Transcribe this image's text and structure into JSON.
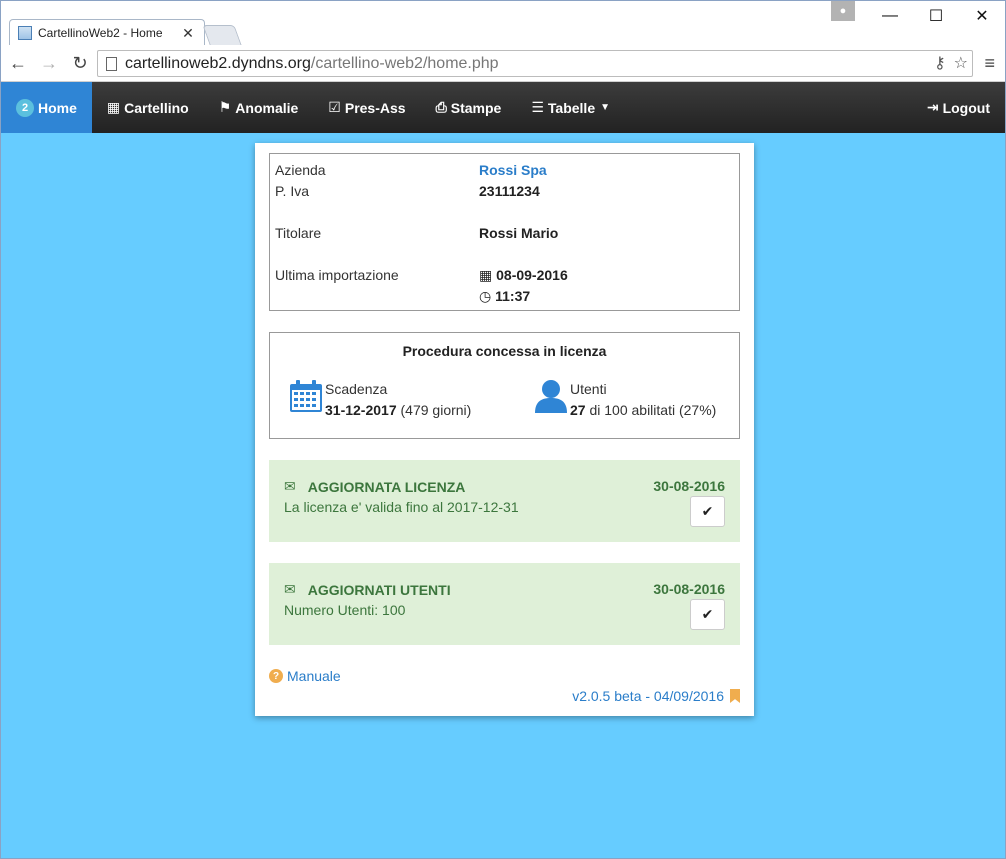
{
  "browser": {
    "tab_title": "CartellinoWeb2 - Home",
    "tab_close": "✕",
    "url_host": "cartellinoweb2.dyndns.org",
    "url_path": "/cartellino-web2/home.php",
    "controls": {
      "minimize": "—",
      "maximize": "☐",
      "close": "✕"
    }
  },
  "navbar": {
    "home_badge": "2",
    "home": "Home",
    "cartellino": "Cartellino",
    "anomalie": "Anomalie",
    "presass": "Pres-Ass",
    "stampe": "Stampe",
    "tabelle": "Tabelle",
    "logout": "Logout"
  },
  "company": {
    "azienda_label": "Azienda",
    "azienda_value": "Rossi Spa",
    "piva_label": "P. Iva",
    "piva_value": "23111234",
    "titolare_label": "Titolare",
    "titolare_value": "Rossi Mario",
    "import_label": "Ultima importazione",
    "import_date": "08-09-2016",
    "import_time": "11:37"
  },
  "license": {
    "title": "Procedura concessa in licenza",
    "scadenza_label": "Scadenza",
    "scadenza_date": "31-12-2017",
    "scadenza_days": "(479 giorni)",
    "utenti_label": "Utenti",
    "utenti_count": "27",
    "utenti_rest": "di 100 abilitati (27%)"
  },
  "notices": [
    {
      "title": "AGGIORNATA LICENZA",
      "date": "30-08-2016",
      "text": "La licenza e' valida fino al 2017-12-31"
    },
    {
      "title": "AGGIORNATI UTENTI",
      "date": "30-08-2016",
      "text": "Numero Utenti: 100"
    }
  ],
  "footer": {
    "manual": "Manuale",
    "version": "v2.0.5 beta - 04/09/2016"
  },
  "colors": {
    "page_bg": "#66ccff",
    "nav_active": "#2f85d5",
    "link": "#2a7dc9",
    "notice_bg": "#dff0d8",
    "notice_text": "#3c763d"
  }
}
